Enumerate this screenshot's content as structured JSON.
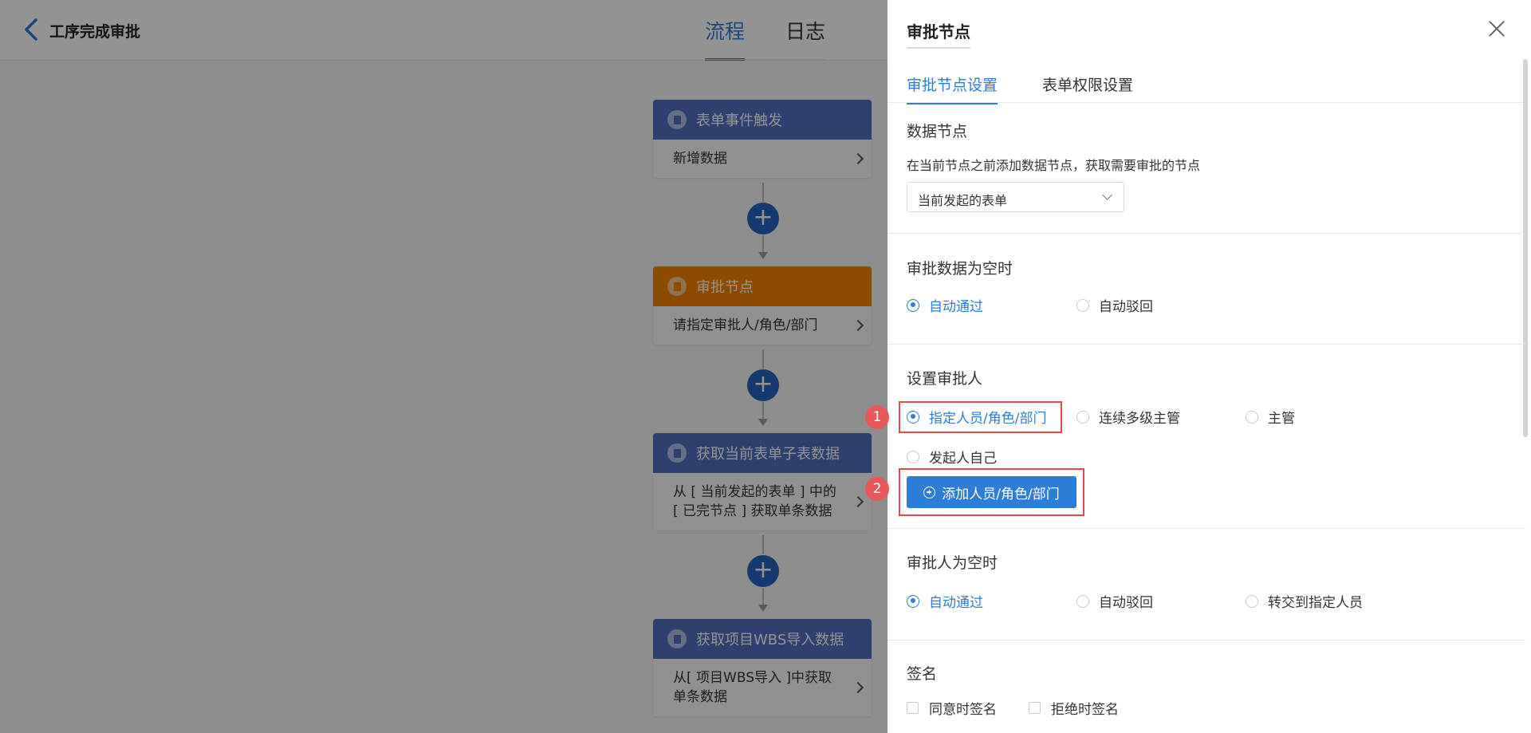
{
  "header": {
    "title": "工序完成审批",
    "tabs": [
      {
        "label": "流程",
        "active": true
      },
      {
        "label": "日志",
        "active": false
      }
    ]
  },
  "flow": {
    "nodes": [
      {
        "title": "表单事件触发",
        "body": "新增数据",
        "color": "#4e6fbd"
      },
      {
        "title": "审批节点",
        "body": "请指定审批人/角色/部门",
        "color": "#f08200"
      },
      {
        "title": "获取当前表单子表数据",
        "body": "从 [ 当前发起的表单 ] 中的 [ 已完节点 ] 获取单条数据",
        "color": "#4e6fbd"
      },
      {
        "title": "获取项目WBS导入数据",
        "body": "从[ 项目WBS导入 ]中获取单条数据",
        "color": "#4e6fbd"
      }
    ],
    "add_symbol": "+"
  },
  "drawer": {
    "title": "审批节点",
    "tabs": [
      {
        "label": "审批节点设置",
        "active": true
      },
      {
        "label": "表单权限设置",
        "active": false
      }
    ],
    "data_node": {
      "title": "数据节点",
      "description": "在当前节点之前添加数据节点，获取需要审批的节点",
      "select_value": "当前发起的表单"
    },
    "empty_data": {
      "title": "审批数据为空时",
      "options": [
        {
          "label": "自动通过",
          "checked": true
        },
        {
          "label": "自动驳回",
          "checked": false
        }
      ]
    },
    "approver": {
      "title": "设置审批人",
      "options": [
        {
          "label": "指定人员/角色/部门",
          "checked": true
        },
        {
          "label": "连续多级主管",
          "checked": false
        },
        {
          "label": "主管",
          "checked": false
        },
        {
          "label": "发起人自己",
          "checked": false
        }
      ],
      "add_button": "添加人员/角色/部门"
    },
    "empty_approver": {
      "title": "审批人为空时",
      "options": [
        {
          "label": "自动通过",
          "checked": true
        },
        {
          "label": "自动驳回",
          "checked": false
        },
        {
          "label": "转交到指定人员",
          "checked": false
        }
      ]
    },
    "signature": {
      "title": "签名",
      "options": [
        {
          "label": "同意时签名",
          "checked": false
        },
        {
          "label": "拒绝时签名",
          "checked": false
        }
      ]
    }
  },
  "annotations": {
    "badges": [
      "1",
      "2"
    ],
    "highlight_color": "#e34a4a"
  },
  "colors": {
    "accent": "#2d7cd6",
    "node_blue": "#4e6fbd",
    "node_orange": "#f08200"
  }
}
